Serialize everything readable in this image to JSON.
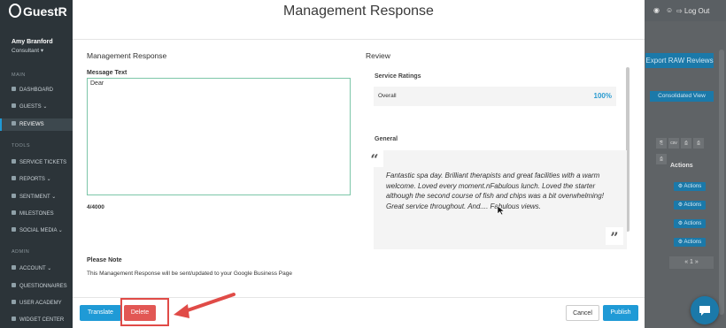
{
  "app": {
    "logo_text": "GuestR"
  },
  "user": {
    "name": "Amy Branford",
    "role": "Consultant ▾"
  },
  "sidebar": {
    "section_main": "MAIN",
    "section_tools": "TOOLS",
    "section_admin": "ADMIN",
    "main_items": [
      {
        "label": "DASHBOARD"
      },
      {
        "label": "GUESTS ⌄"
      },
      {
        "label": "REVIEWS"
      }
    ],
    "tools_items": [
      {
        "label": "SERVICE TICKETS"
      },
      {
        "label": "REPORTS ⌄"
      },
      {
        "label": "SENTIMENT ⌄"
      },
      {
        "label": "MILESTONES"
      },
      {
        "label": "SOCIAL MEDIA ⌄"
      }
    ],
    "admin_items": [
      {
        "label": "ACCOUNT ⌄"
      },
      {
        "label": "QUESTIONNAIRES"
      },
      {
        "label": "USER ACADEMY"
      },
      {
        "label": "WIDGET CENTER"
      }
    ]
  },
  "background": {
    "logout": "Log Out",
    "export_button": "Export RAW Reviews",
    "consolidated_button": "Consolidated View",
    "toolbar": [
      "⎘",
      "csv",
      "⎙",
      "⎙",
      "⎙"
    ],
    "actions_header": "Actions",
    "action_label": "⚙ Actions",
    "pager": "«   1   »"
  },
  "modal": {
    "title": "Management Response",
    "left_heading": "Management Response",
    "message_label": "Message Text",
    "message_value": "Dear",
    "counter": "4/4000",
    "note_title": "Please Note",
    "note_text": "This Management Response will be sent/updated to your Google Business Page",
    "review_heading": "Review",
    "service_ratings_title": "Service Ratings",
    "rating_label": "Overall",
    "rating_value": "100%",
    "general_title": "General",
    "review_text": "Fantastic spa day. Brilliant therapists and great facilities with a warm welcome. Loved every moment.nFabulous lunch. Loved the starter although the second course of fish and chips was a bit overwhelming! Great service throughout. And.... Fabulous views.",
    "buttons": {
      "translate": "Translate",
      "delete": "Delete",
      "cancel": "Cancel",
      "publish": "Publish"
    }
  },
  "colors": {
    "primary": "#1f9ad6",
    "danger": "#e25754",
    "annotation": "#e04b47",
    "sidebar": "#2c3439"
  }
}
